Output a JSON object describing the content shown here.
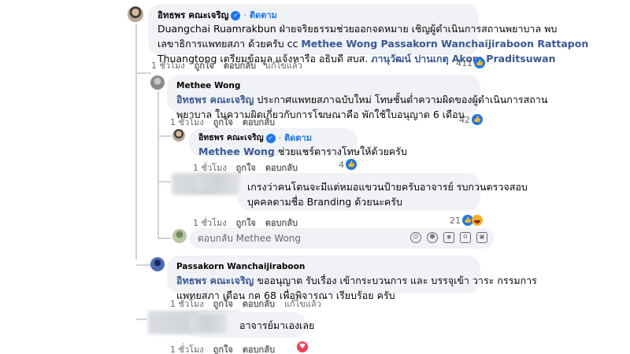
{
  "comments": [
    {
      "author": "อิทธพร คณะเจริญ",
      "follow": "ติดตาม",
      "lines": [
        "Duangchai Ruamrakbun ฝ่ายจริยธรรมช่วยออกจดหมาย เชิญผู้ดำเนินการสถานพยาบาล พบ",
        "เลขาธิการแพทยสภา ด้วยครับ cc",
        "Thuangtong เตรียมข้อมูล แจ้งหารือ อธิบดี สบส."
      ],
      "mentions_line2": "Methee Wong Passakorn Wanchaijiraboon Rattapon",
      "mentions_line3": "ภานุวัฒน์ ปานเกตุ",
      "mentions_line3b": "Akom Praditsuwan",
      "time": "1 ชั่วโมง",
      "like": "ถูกใจ",
      "reply": "ตอบกลับ",
      "edited": "แก้ไขแล้ว",
      "count": "411"
    },
    {
      "author": "Methee Wong",
      "mention": "อิทธพร คณะเจริญ",
      "line1": "ประกาศแพทยสภาฉบับใหม่ โทษชั้นต่ำความผิดของผู้ดำเนินการสถาน",
      "line2": "พยาบาล ในความผิดเกี่ยวกับการโฆษณาคือ พักใช้ใบอนุญาต 6 เดือน",
      "time": "1 ชั่วโมง",
      "like": "ถูกใจ",
      "reply": "ตอบกลับ",
      "count": "42"
    },
    {
      "author": "อิทธพร คณะเจริญ",
      "follow": "ติดตาม",
      "mention": "Methee Wong",
      "line1": "ช่วยแชร์ตารางโทษให้ด้วยครับ",
      "time": "1 ชั่วโมง",
      "like": "ถูกใจ",
      "reply": "ตอบกลับ",
      "count": "4"
    },
    {
      "line1": "เกรงว่าคนโดนจะมีแต่หมอแขวนป้ายครับอาจารย์ รบกวนตรวจสอบ",
      "line2": "บุคคลตามชื่อ Branding ด้วยนะครับ",
      "time": "1 ชั่วโมง",
      "like": "ถูกใจ",
      "reply": "ตอบกลับ",
      "count": "21"
    },
    {
      "author": "Passakorn Wanchaijiraboon",
      "mention": "อิทธพร คณะเจริญ",
      "line1": "ขออนุญาต รับเรื่อง เข้ากระบวนการ และ บรรจุเข้า วาระ กรรมการ",
      "line2": "แพทยสภา เดือน กค 68 เพื่อพิจารณา เรียบร้อย ครับ",
      "time": "1 ชั่วโมง",
      "like": "ถูกใจ",
      "reply": "ตอบกลับ",
      "edited": "แก้ไขแล้ว"
    },
    {
      "line1": "อาจารย์มาเองเลย",
      "time": "1 ชั่วโมง",
      "like": "ถูกใจ",
      "reply": "ตอบกลับ"
    }
  ],
  "reply_box": {
    "placeholder": "ตอบกลับ Methee Wong"
  },
  "icons": {
    "like": "thumbs-up-icon",
    "haha": "haha-icon",
    "love": "heart-icon",
    "verified": "verified-badge-icon"
  },
  "colors": {
    "accent": "#1877f2",
    "bubble": "#f0f2f5",
    "meta": "#65676b"
  }
}
